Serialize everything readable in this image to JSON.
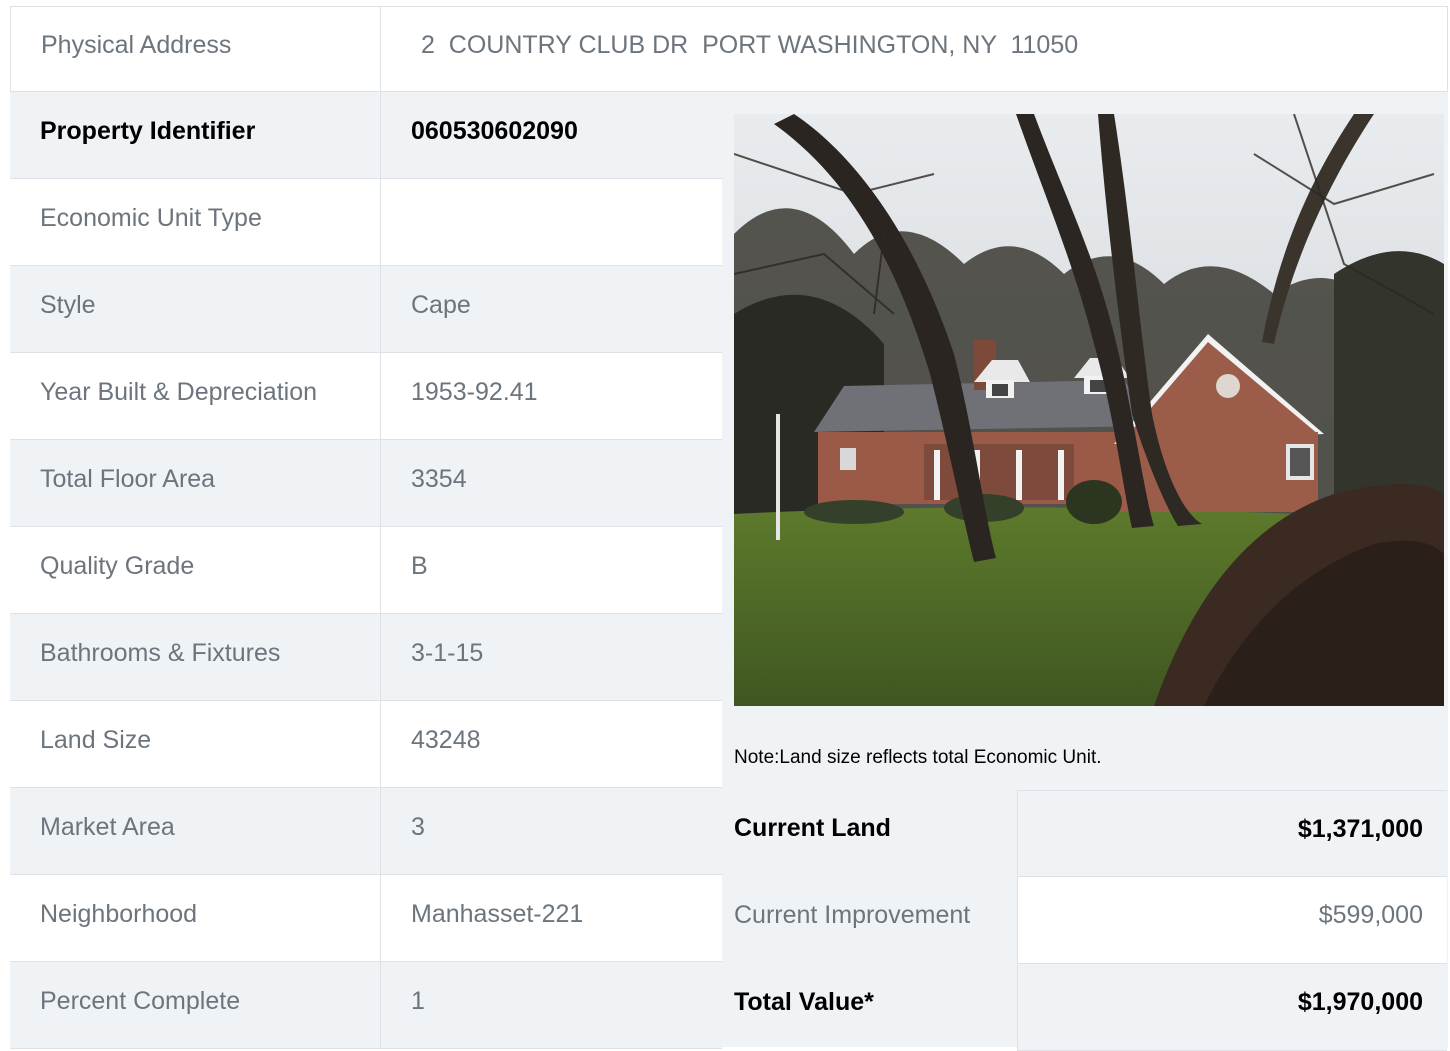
{
  "address": {
    "label": "Physical Address",
    "value": "2  COUNTRY CLUB DR  PORT WASHINGTON, NY  11050"
  },
  "details": [
    {
      "label": "Property Identifier",
      "value": "060530602090"
    },
    {
      "label": "Economic Unit Type",
      "value": ""
    },
    {
      "label": "Style",
      "value": "Cape"
    },
    {
      "label": "Year Built & Depreciation",
      "value": "1953-92.41"
    },
    {
      "label": "Total Floor Area",
      "value": "3354"
    },
    {
      "label": "Quality Grade",
      "value": "B"
    },
    {
      "label": "Bathrooms & Fixtures",
      "value": "3-1-15"
    },
    {
      "label": "Land Size",
      "value": "43248"
    },
    {
      "label": "Market Area",
      "value": "3"
    },
    {
      "label": "Neighborhood",
      "value": "Manhasset-221"
    },
    {
      "label": "Percent Complete",
      "value": "1"
    }
  ],
  "note": "Note:Land size reflects total Economic Unit.",
  "valuation": [
    {
      "label": "Current Land",
      "value": "$1,371,000"
    },
    {
      "label": "Current Improvement",
      "value": "$599,000"
    },
    {
      "label": "Total Value*",
      "value": "$1,970,000"
    }
  ]
}
